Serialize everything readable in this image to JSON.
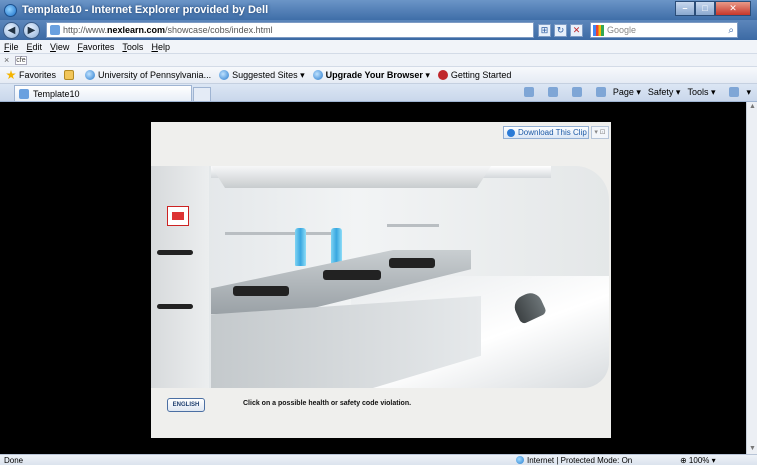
{
  "window": {
    "title": "Template10 - Internet Explorer provided by Dell",
    "min": "–",
    "max": "□",
    "close": "✕"
  },
  "addressbar": {
    "url_prefix": "http://www.",
    "url_domain": "nexlearn.com",
    "url_path": "/showcase/cobs/index.html",
    "search_placeholder": "Google",
    "back": "◀",
    "forward": "▶",
    "refresh": "↻",
    "stop": "✕",
    "compat": "⊞",
    "search_go": "⌕"
  },
  "menu": {
    "items": [
      {
        "key": "F",
        "rest": "ile"
      },
      {
        "key": "E",
        "rest": "dit"
      },
      {
        "key": "V",
        "rest": "iew"
      },
      {
        "key": "F",
        "rest": "avorites"
      },
      {
        "key": "T",
        "rest": "ools"
      },
      {
        "key": "H",
        "rest": "elp"
      }
    ]
  },
  "findbar": {
    "close": "×",
    "text": "cfe"
  },
  "favorites": {
    "label": "Favorites",
    "items": [
      "University of Pennsylvania...",
      "Suggested Sites ▾",
      "Upgrade Your Browser ▾",
      "Getting Started"
    ]
  },
  "tab": {
    "title": "Template10"
  },
  "commandbar": {
    "page": "Page ▾",
    "safety": "Safety ▾",
    "tools": "Tools ▾",
    "help": "▾"
  },
  "player": {
    "download_label": "Download This Clip",
    "clip_tools": "▾ ⊡",
    "language_button": "ENGLISH",
    "instruction": "Click on a possible health or safety code violation."
  },
  "status": {
    "left": "Done",
    "zone": "Internet | Protected Mode: On",
    "zoom": "⊕ 100% ▾"
  },
  "colors": {
    "titlebar": "#3f6ea8",
    "content_bg": "#000000",
    "link_blue": "#1d5aa6"
  }
}
